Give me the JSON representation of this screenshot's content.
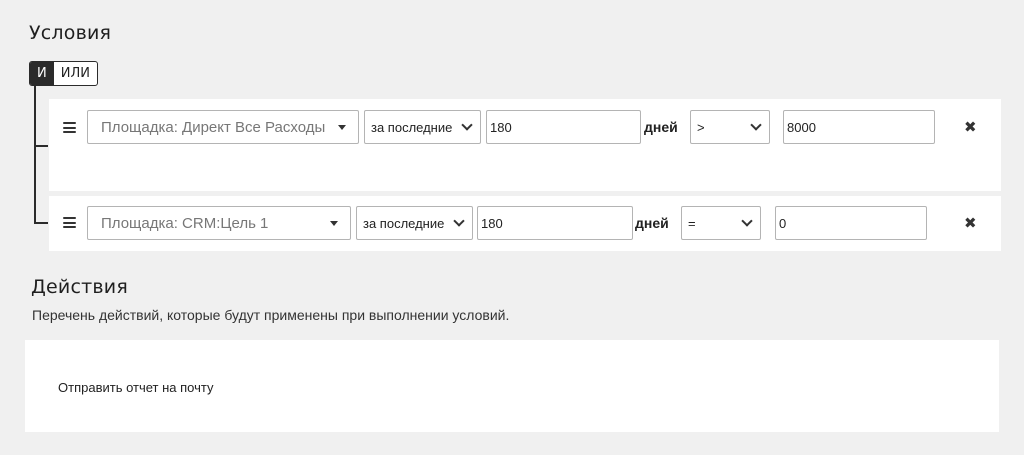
{
  "conditions": {
    "title": "Условия",
    "logic": {
      "and_label": "И",
      "or_label": "ИЛИ",
      "selected": "И"
    },
    "rows": [
      {
        "platform": "Площадка: Директ Все Расходы",
        "period": "за последние",
        "days": "180",
        "unit": "дней",
        "operator": ">",
        "value": "8000"
      },
      {
        "platform": "Площадка: CRM:Цель 1",
        "period": "за последние",
        "days": "180",
        "unit": "дней",
        "operator": "=",
        "value": "0"
      }
    ],
    "remove_glyph": "✖",
    "handle_icon": "hamburger-icon"
  },
  "actions": {
    "title": "Действия",
    "subtitle": "Перечень действий, которые будут применены при выполнении условий.",
    "items": [
      {
        "label": "Отправить отчет на почту"
      }
    ]
  }
}
